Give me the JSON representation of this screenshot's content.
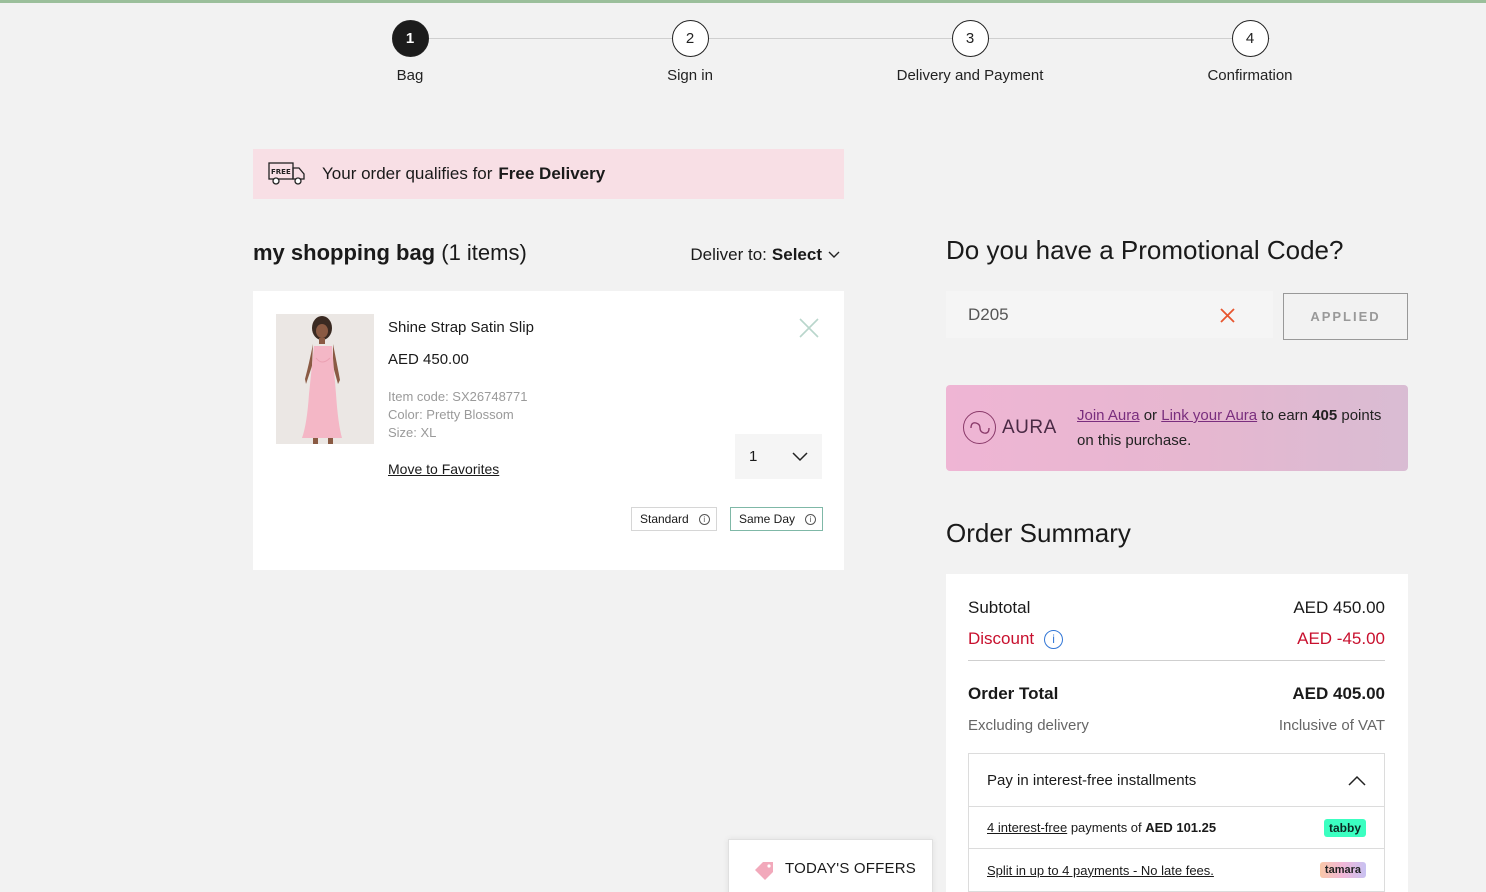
{
  "stepper": {
    "steps": [
      {
        "num": "1",
        "label": "Bag"
      },
      {
        "num": "2",
        "label": "Sign in"
      },
      {
        "num": "3",
        "label": "Delivery and Payment"
      },
      {
        "num": "4",
        "label": "Confirmation"
      }
    ]
  },
  "banner": {
    "icon_text": "FREE",
    "text": "Your order qualifies for",
    "bold": "Free Delivery"
  },
  "bag": {
    "title_bold": "my shopping bag",
    "count": "(1 items)",
    "deliver_label": "Deliver to:",
    "deliver_value": "Select"
  },
  "product": {
    "name": "Shine Strap Satin Slip",
    "price": "AED  450.00",
    "item_code": "Item code: SX26748771",
    "color": "Color: Pretty Blossom",
    "size": "Size: XL",
    "favorites": "Move to Favorites",
    "qty": "1",
    "shipping": [
      "Standard",
      "Same Day"
    ]
  },
  "promo": {
    "title": "Do you have a Promotional Code?",
    "code": "D205",
    "button": "APPLIED"
  },
  "aura": {
    "logo": "AURA",
    "join": "Join Aura",
    "or": "or",
    "link": "Link your Aura",
    "earn": "to earn",
    "points": "405",
    "rest": "points on this purchase."
  },
  "summary": {
    "title": "Order Summary",
    "subtotal_label": "Subtotal",
    "subtotal_value": "AED 450.00",
    "discount_label": "Discount",
    "discount_value": "AED -45.00",
    "total_label": "Order Total",
    "total_value": "AED 405.00",
    "excl": "Excluding delivery",
    "incl": "Inclusive of VAT",
    "install_title": "Pay in interest-free installments",
    "tabby_link": "4 interest-free",
    "tabby_text": "payments of",
    "tabby_amount": "AED 101.25",
    "tabby_badge": "tabby",
    "tamara_link": "Split in up to 4 payments - No late fees.",
    "tamara_badge": "tamara"
  },
  "offers": {
    "label": "TODAY'S OFFERS"
  },
  "colors": {
    "banner_bg": "#f8dfe5",
    "discount": "#c8102e",
    "aura_link": "#7a2e7e",
    "tabby": "#3bffc1"
  }
}
